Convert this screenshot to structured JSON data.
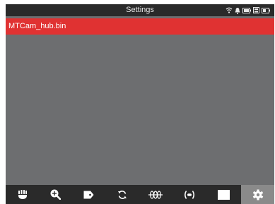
{
  "header": {
    "title": "Settings"
  },
  "status_icons": [
    "wifi-icon",
    "bell-icon",
    "battery-icon",
    "sd-card-icon",
    "battery-icon"
  ],
  "file_list": {
    "items": [
      {
        "name": "MTCam_hub.bin",
        "selected": true
      }
    ]
  },
  "toolbar": {
    "buttons": [
      {
        "icon": "hand-icon",
        "active": false
      },
      {
        "icon": "zoom-in-icon",
        "active": false
      },
      {
        "icon": "tag-icon",
        "active": false
      },
      {
        "icon": "rotate-icon",
        "active": false
      },
      {
        "icon": "coil-icon",
        "active": false
      },
      {
        "icon": "signal-icon",
        "active": false
      },
      {
        "icon": "blank-icon",
        "active": false
      },
      {
        "icon": "gear-icon",
        "active": true
      }
    ]
  },
  "colors": {
    "accent": "#e03232",
    "background": "#6d6e70",
    "bar": "#2a2a2a",
    "active_tab": "#8a8a8a"
  }
}
